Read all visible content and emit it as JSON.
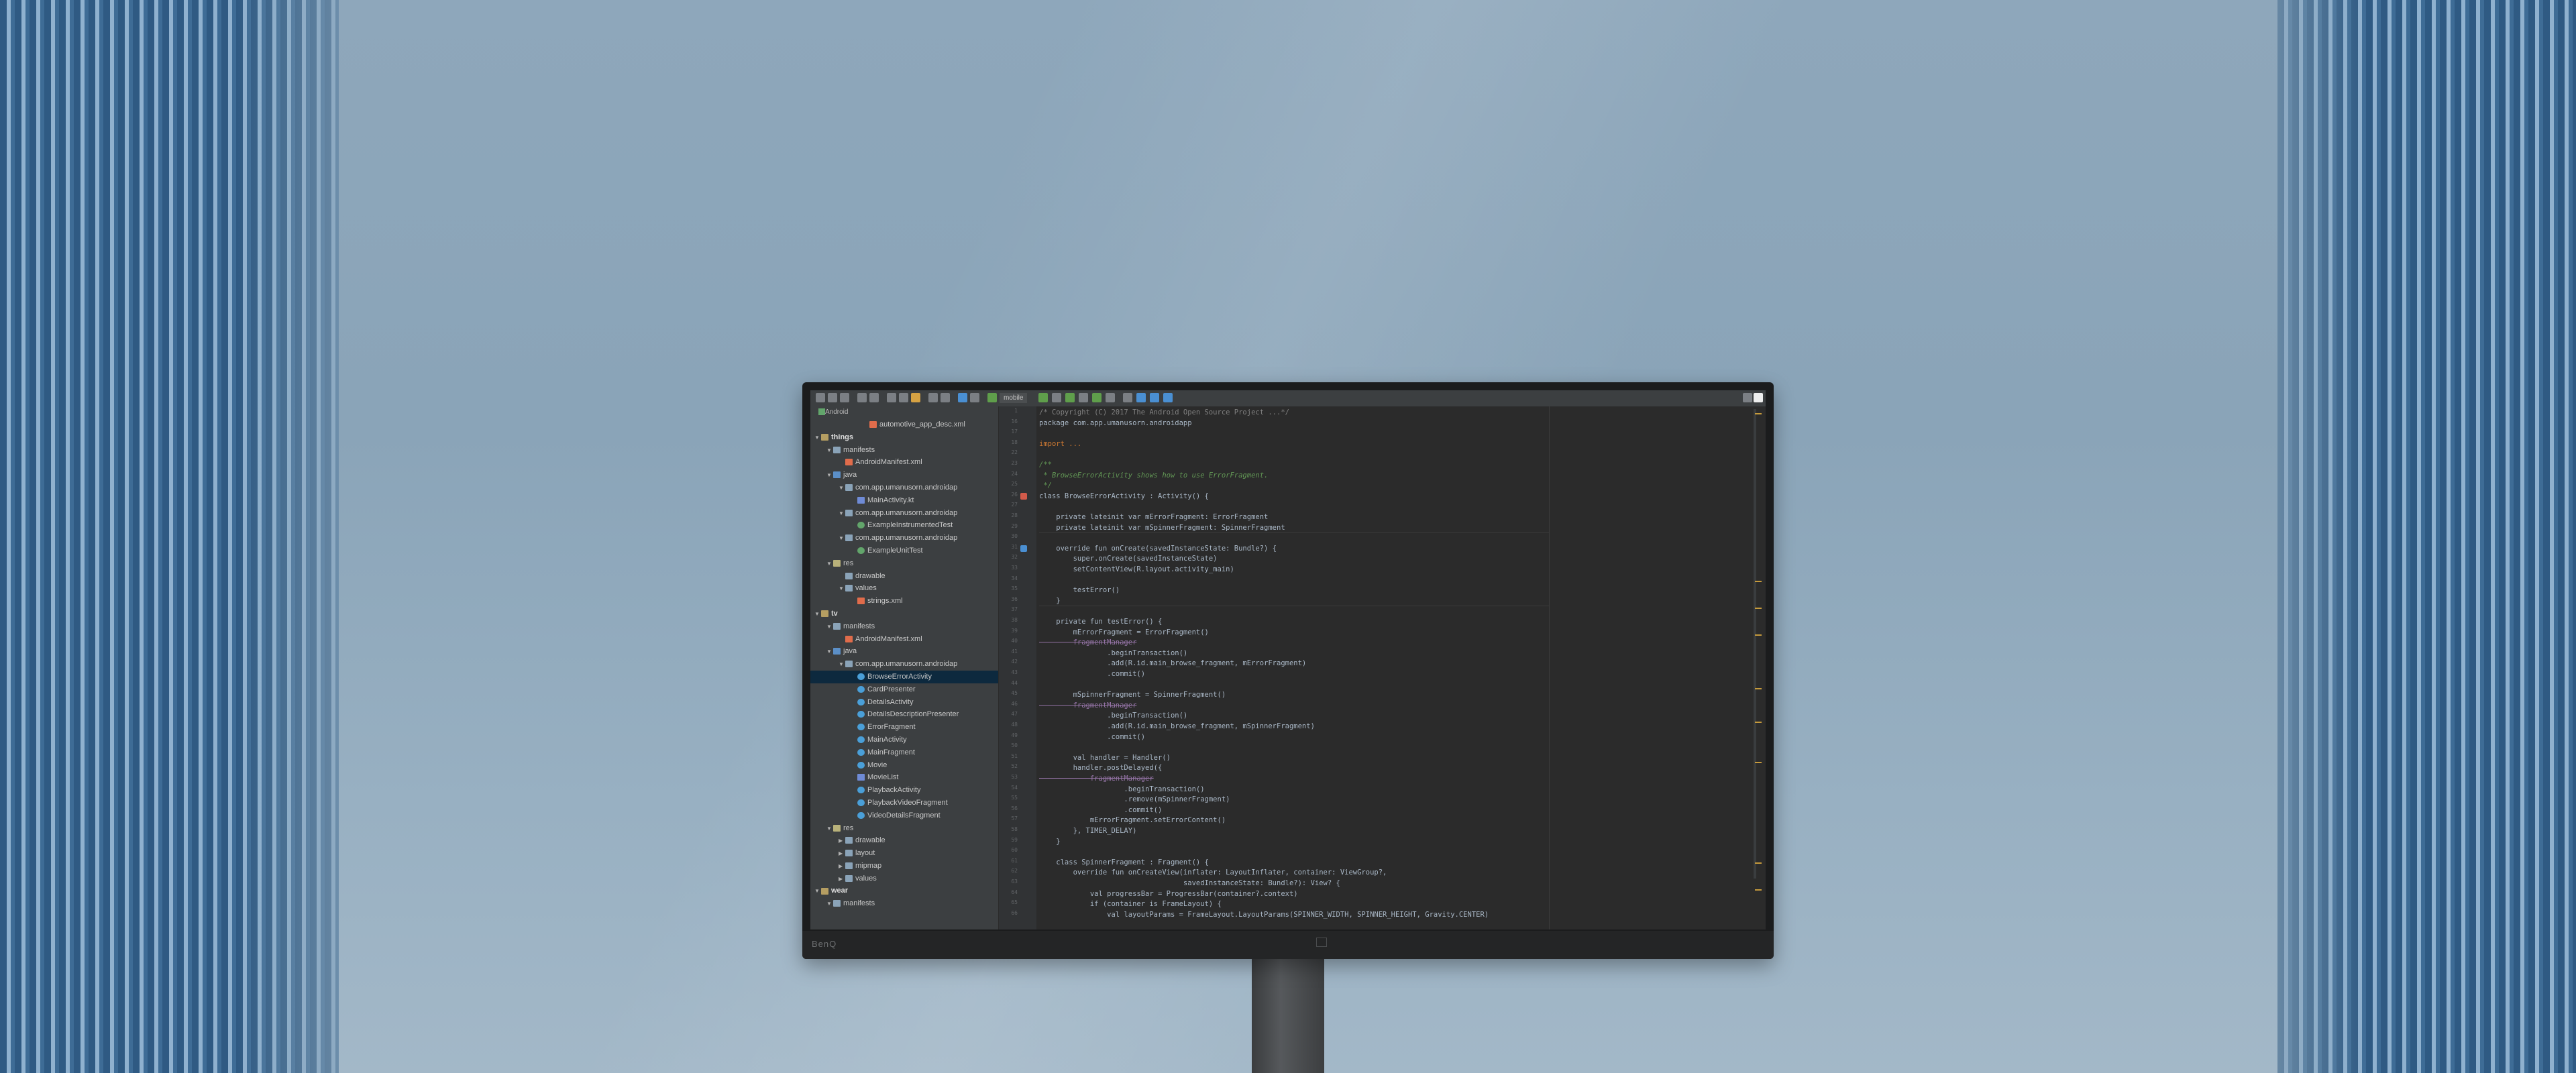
{
  "window": {
    "run_config": "mobile"
  },
  "sidebar": {
    "view_selector": "Android",
    "items": [
      {
        "label": "automotive_app_desc.xml",
        "indent": 4,
        "icon": "xml",
        "twisty": ""
      },
      {
        "label": "things",
        "indent": 0,
        "icon": "mod",
        "twisty": "▼",
        "bold": true
      },
      {
        "label": "manifests",
        "indent": 1,
        "icon": "folder",
        "twisty": "▼"
      },
      {
        "label": "AndroidManifest.xml",
        "indent": 2,
        "icon": "xml",
        "twisty": ""
      },
      {
        "label": "java",
        "indent": 1,
        "icon": "src",
        "twisty": "▼"
      },
      {
        "label": "com.app.umanusorn.androidap",
        "indent": 2,
        "icon": "folder",
        "twisty": "▼"
      },
      {
        "label": "MainActivity.kt",
        "indent": 3,
        "icon": "kt",
        "twisty": ""
      },
      {
        "label": "com.app.umanusorn.androidap",
        "indent": 2,
        "icon": "folder",
        "twisty": "▼"
      },
      {
        "label": "ExampleInstrumentedTest",
        "indent": 3,
        "icon": "test",
        "twisty": ""
      },
      {
        "label": "com.app.umanusorn.androidap",
        "indent": 2,
        "icon": "folder",
        "twisty": "▼"
      },
      {
        "label": "ExampleUnitTest",
        "indent": 3,
        "icon": "test",
        "twisty": ""
      },
      {
        "label": "res",
        "indent": 1,
        "icon": "res",
        "twisty": "▼"
      },
      {
        "label": "drawable",
        "indent": 2,
        "icon": "folder",
        "twisty": ""
      },
      {
        "label": "values",
        "indent": 2,
        "icon": "folder",
        "twisty": "▼"
      },
      {
        "label": "strings.xml",
        "indent": 3,
        "icon": "xml",
        "twisty": ""
      },
      {
        "label": "tv",
        "indent": 0,
        "icon": "mod",
        "twisty": "▼",
        "bold": true
      },
      {
        "label": "manifests",
        "indent": 1,
        "icon": "folder",
        "twisty": "▼"
      },
      {
        "label": "AndroidManifest.xml",
        "indent": 2,
        "icon": "xml",
        "twisty": ""
      },
      {
        "label": "java",
        "indent": 1,
        "icon": "src",
        "twisty": "▼"
      },
      {
        "label": "com.app.umanusorn.androidap",
        "indent": 2,
        "icon": "folder",
        "twisty": "▼"
      },
      {
        "label": "BrowseErrorActivity",
        "indent": 3,
        "icon": "cls",
        "twisty": "",
        "selected": true
      },
      {
        "label": "CardPresenter",
        "indent": 3,
        "icon": "cls",
        "twisty": ""
      },
      {
        "label": "DetailsActivity",
        "indent": 3,
        "icon": "cls",
        "twisty": ""
      },
      {
        "label": "DetailsDescriptionPresenter",
        "indent": 3,
        "icon": "cls",
        "twisty": ""
      },
      {
        "label": "ErrorFragment",
        "indent": 3,
        "icon": "cls",
        "twisty": ""
      },
      {
        "label": "MainActivity",
        "indent": 3,
        "icon": "cls",
        "twisty": ""
      },
      {
        "label": "MainFragment",
        "indent": 3,
        "icon": "cls",
        "twisty": ""
      },
      {
        "label": "Movie",
        "indent": 3,
        "icon": "cls",
        "twisty": ""
      },
      {
        "label": "MovieList",
        "indent": 3,
        "icon": "kt",
        "twisty": ""
      },
      {
        "label": "PlaybackActivity",
        "indent": 3,
        "icon": "cls",
        "twisty": ""
      },
      {
        "label": "PlaybackVideoFragment",
        "indent": 3,
        "icon": "cls",
        "twisty": ""
      },
      {
        "label": "VideoDetailsFragment",
        "indent": 3,
        "icon": "cls",
        "twisty": ""
      },
      {
        "label": "res",
        "indent": 1,
        "icon": "res",
        "twisty": "▼"
      },
      {
        "label": "drawable",
        "indent": 2,
        "icon": "folder",
        "twisty": "▶"
      },
      {
        "label": "layout",
        "indent": 2,
        "icon": "folder",
        "twisty": "▶"
      },
      {
        "label": "mipmap",
        "indent": 2,
        "icon": "folder",
        "twisty": "▶"
      },
      {
        "label": "values",
        "indent": 2,
        "icon": "folder",
        "twisty": "▶"
      },
      {
        "label": "wear",
        "indent": 0,
        "icon": "mod",
        "twisty": "▼",
        "bold": true
      },
      {
        "label": "manifests",
        "indent": 1,
        "icon": "folder",
        "twisty": "▼"
      }
    ]
  },
  "editor": {
    "lines": [
      {
        "n": "1",
        "t": "/* Copyright (C) 2017 The Android Open Source Project ...*/",
        "c": "gray"
      },
      {
        "n": "16",
        "t": "package com.app.umanusorn.androidapp",
        "c": ""
      },
      {
        "n": "17",
        "t": "",
        "c": ""
      },
      {
        "n": "18",
        "t": "import ...",
        "c": "kw"
      },
      {
        "n": "22",
        "t": "",
        "c": ""
      },
      {
        "n": "23",
        "t": "/**",
        "c": "cm"
      },
      {
        "n": "24",
        "t": " * BrowseErrorActivity shows how to use ErrorFragment.",
        "c": "cm"
      },
      {
        "n": "25",
        "t": " */",
        "c": "cm"
      },
      {
        "n": "26",
        "t": "class BrowseErrorActivity : Activity() {",
        "c": "",
        "hl": "class"
      },
      {
        "n": "27",
        "t": "",
        "c": ""
      },
      {
        "n": "28",
        "t": "    private lateinit var mErrorFragment: ErrorFragment",
        "c": ""
      },
      {
        "n": "29",
        "t": "    private lateinit var mSpinnerFragment: SpinnerFragment",
        "c": ""
      },
      {
        "n": "30",
        "t": "",
        "c": ""
      },
      {
        "n": "31",
        "t": "    override fun onCreate(savedInstanceState: Bundle?) {",
        "c": ""
      },
      {
        "n": "32",
        "t": "        super.onCreate(savedInstanceState)",
        "c": ""
      },
      {
        "n": "33",
        "t": "        setContentView(R.layout.activity_main)",
        "c": ""
      },
      {
        "n": "34",
        "t": "",
        "c": ""
      },
      {
        "n": "35",
        "t": "        testError()",
        "c": ""
      },
      {
        "n": "36",
        "t": "    }",
        "c": ""
      },
      {
        "n": "37",
        "t": "",
        "c": ""
      },
      {
        "n": "38",
        "t": "    private fun testError() {",
        "c": ""
      },
      {
        "n": "39",
        "t": "        mErrorFragment = ErrorFragment()",
        "c": ""
      },
      {
        "n": "40",
        "t": "        fragmentManager",
        "c": "strike"
      },
      {
        "n": "41",
        "t": "                .beginTransaction()",
        "c": ""
      },
      {
        "n": "42",
        "t": "                .add(R.id.main_browse_fragment, mErrorFragment)",
        "c": ""
      },
      {
        "n": "43",
        "t": "                .commit()",
        "c": ""
      },
      {
        "n": "44",
        "t": "",
        "c": ""
      },
      {
        "n": "45",
        "t": "        mSpinnerFragment = SpinnerFragment()",
        "c": ""
      },
      {
        "n": "46",
        "t": "        fragmentManager",
        "c": "strike"
      },
      {
        "n": "47",
        "t": "                .beginTransaction()",
        "c": ""
      },
      {
        "n": "48",
        "t": "                .add(R.id.main_browse_fragment, mSpinnerFragment)",
        "c": ""
      },
      {
        "n": "49",
        "t": "                .commit()",
        "c": ""
      },
      {
        "n": "50",
        "t": "",
        "c": ""
      },
      {
        "n": "51",
        "t": "        val handler = Handler()",
        "c": ""
      },
      {
        "n": "52",
        "t": "        handler.postDelayed({",
        "c": ""
      },
      {
        "n": "53",
        "t": "            fragmentManager",
        "c": "strike"
      },
      {
        "n": "54",
        "t": "                    .beginTransaction()",
        "c": ""
      },
      {
        "n": "55",
        "t": "                    .remove(mSpinnerFragment)",
        "c": ""
      },
      {
        "n": "56",
        "t": "                    .commit()",
        "c": ""
      },
      {
        "n": "57",
        "t": "            mErrorFragment.setErrorContent()",
        "c": ""
      },
      {
        "n": "58",
        "t": "        }, TIMER_DELAY)",
        "c": ""
      },
      {
        "n": "59",
        "t": "    }",
        "c": ""
      },
      {
        "n": "60",
        "t": "",
        "c": ""
      },
      {
        "n": "61",
        "t": "    class SpinnerFragment : Fragment() {",
        "c": ""
      },
      {
        "n": "62",
        "t": "        override fun onCreateView(inflater: LayoutInflater, container: ViewGroup?,",
        "c": ""
      },
      {
        "n": "63",
        "t": "                                  savedInstanceState: Bundle?): View? {",
        "c": ""
      },
      {
        "n": "64",
        "t": "            val progressBar = ProgressBar(container?.context)",
        "c": ""
      },
      {
        "n": "65",
        "t": "            if (container is FrameLayout) {",
        "c": ""
      },
      {
        "n": "66",
        "t": "                val layoutParams = FrameLayout.LayoutParams(SPINNER_WIDTH, SPINNER_HEIGHT, Gravity.CENTER)",
        "c": ""
      }
    ]
  },
  "monitor": {
    "brand": "BenQ"
  },
  "colors": {
    "accent": "#4a8fd2",
    "selection": "#0d293e",
    "editor_bg": "#2b2b2b",
    "keyword": "#cc7832",
    "function": "#ffc66d"
  }
}
